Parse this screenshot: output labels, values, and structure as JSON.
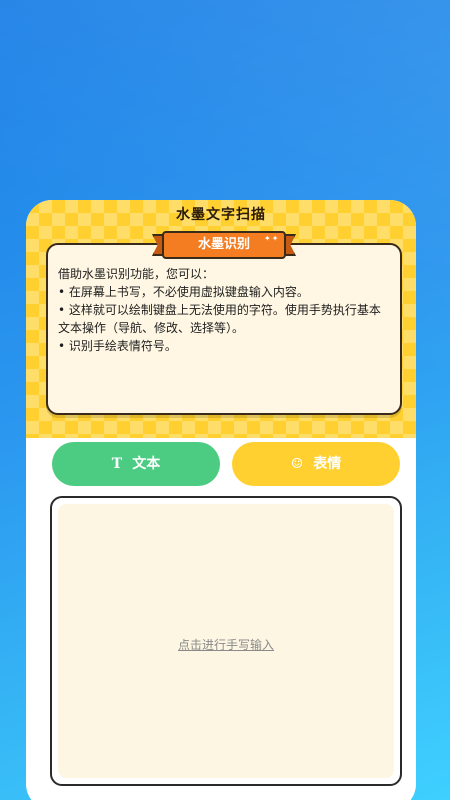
{
  "card": {
    "title": "水墨文字扫描",
    "badge": "水墨识别",
    "description": {
      "intro": "借助水墨识别功能，您可以：",
      "bullet1": "• 在屏幕上书写，不必使用虚拟键盘输入内容。",
      "bullet2": "• 这样就可以绘制键盘上无法使用的字符。使用手势执行基本",
      "bullet2b": "文本操作（导航、修改、选择等）。",
      "bullet3": "• 识别手绘表情符号。"
    }
  },
  "tabs": [
    {
      "label": "文本",
      "icon": "text-icon",
      "glyph": "T",
      "color": "#4ccb83"
    },
    {
      "label": "表情",
      "icon": "smiley-icon",
      "glyph": "☺",
      "color": "#ffd02f"
    }
  ],
  "write_area": {
    "hint": "点击进行手写输入"
  },
  "colors": {
    "background": "#2b97ef",
    "header": "#ffd02f",
    "badge": "#f37d20",
    "text_tab": "#4ccb83",
    "emoji_tab": "#ffd02f"
  }
}
